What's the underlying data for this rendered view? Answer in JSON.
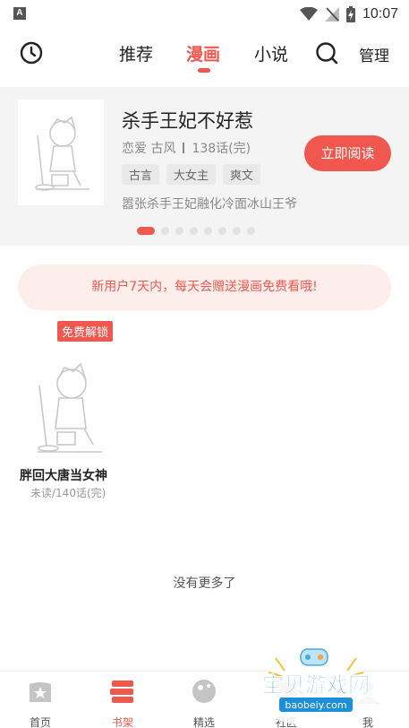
{
  "status_bar": {
    "app_icon_letter": "A",
    "time": "10:07"
  },
  "top_nav": {
    "tabs": [
      {
        "label": "推荐",
        "active": false
      },
      {
        "label": "漫画",
        "active": true
      },
      {
        "label": "小说",
        "active": false
      }
    ],
    "manage_label": "管理"
  },
  "banner": {
    "title": "杀手王妃不好惹",
    "genres": "恋爱 古风",
    "chapters": "138话(完)",
    "tags": [
      "古言",
      "大女主",
      "爽文"
    ],
    "description": "嚣张杀手王妃融化冷面冰山王爷",
    "read_button": "立即阅读",
    "page_count": 8,
    "active_page": 0
  },
  "notice": "新用户7天内，每天会赠送漫画免费看哦!",
  "books": [
    {
      "badge": "免费解锁",
      "title": "胖回大唐当女神",
      "progress": "未读/140话(完)"
    }
  ],
  "footer_text": "没有更多了",
  "bottom_nav": [
    {
      "label": "首页",
      "icon": "home-star-icon",
      "active": false
    },
    {
      "label": "书架",
      "icon": "bookshelf-icon",
      "active": true
    },
    {
      "label": "精选",
      "icon": "featured-icon",
      "active": false
    },
    {
      "label": "社区",
      "icon": "community-icon",
      "active": false
    },
    {
      "label": "我",
      "icon": "profile-icon",
      "active": false
    }
  ],
  "watermark": {
    "text": "宝贝游戏网",
    "url": "baobeiy.com"
  },
  "colors": {
    "accent": "#f0584f",
    "notice_bg": "#fdeeec",
    "banner_bg": "#f4f4f4"
  }
}
